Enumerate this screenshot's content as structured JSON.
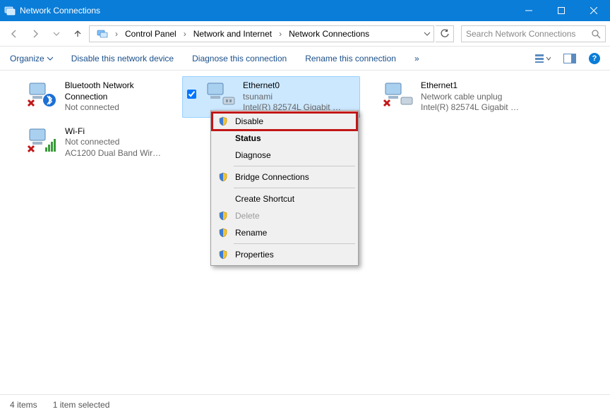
{
  "window": {
    "title": "Network Connections"
  },
  "breadcrumb": {
    "seg1": "Control Panel",
    "seg2": "Network and Internet",
    "seg3": "Network Connections"
  },
  "search": {
    "placeholder": "Search Network Connections"
  },
  "toolbar": {
    "organize": "Organize",
    "disable": "Disable this network device",
    "diagnose": "Diagnose this connection",
    "rename": "Rename this connection",
    "more": "»"
  },
  "connections": [
    {
      "name": "Bluetooth Network Connection",
      "line2": "Not connected",
      "line3": "",
      "icon": "bluetooth",
      "status": "error"
    },
    {
      "name": "Ethernet0",
      "line2": "tsunami",
      "line3": "Intel(R) 82574L Gigabit …",
      "icon": "ethernet",
      "status": "ok",
      "selected": true,
      "checked": true
    },
    {
      "name": "Ethernet1",
      "line2": "Network cable unplug",
      "line3": "Intel(R) 82574L Gigabit …",
      "icon": "ethernet",
      "status": "error"
    },
    {
      "name": "Wi-Fi",
      "line2": "Not connected",
      "line3": "AC1200  Dual Band Wir…",
      "icon": "wifi",
      "status": "error"
    }
  ],
  "context_menu": {
    "items": [
      {
        "label": "Disable",
        "shield": true,
        "highlight": true
      },
      {
        "label": "Status",
        "bold": true
      },
      {
        "label": "Diagnose"
      },
      {
        "sep": true
      },
      {
        "label": "Bridge Connections",
        "shield": true
      },
      {
        "sep": true
      },
      {
        "label": "Create Shortcut"
      },
      {
        "label": "Delete",
        "shield": true,
        "disabled": true
      },
      {
        "label": "Rename",
        "shield": true
      },
      {
        "sep": true
      },
      {
        "label": "Properties",
        "shield": true
      }
    ]
  },
  "status": {
    "count": "4 items",
    "selected": "1 item selected"
  }
}
